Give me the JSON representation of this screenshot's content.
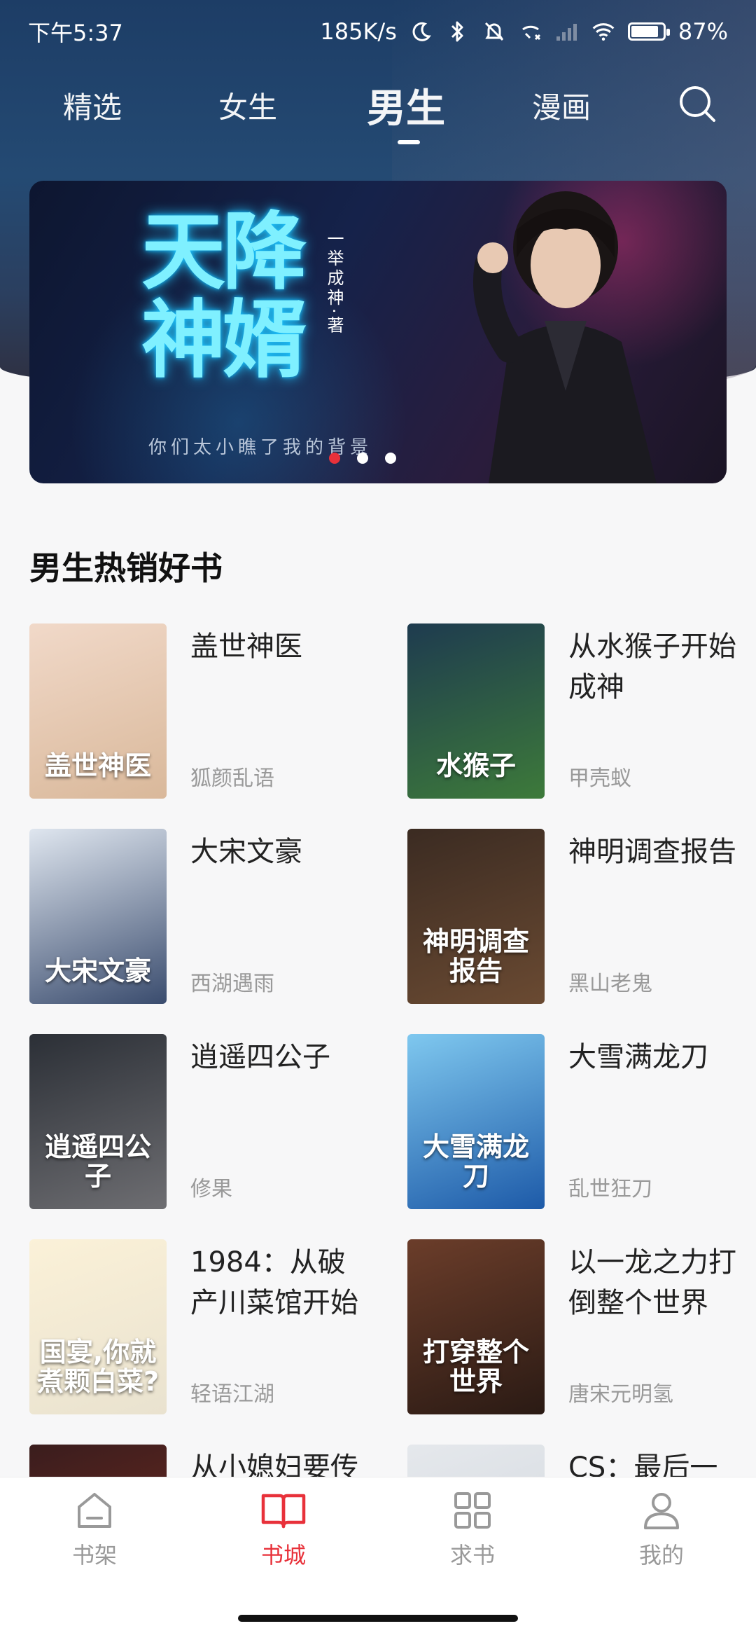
{
  "status_bar": {
    "time": "下午5:37",
    "speed": "185K/s",
    "battery_text": "87%",
    "battery_level": 0.87
  },
  "tabs": [
    {
      "label": "精选"
    },
    {
      "label": "女生"
    },
    {
      "label": "男生"
    },
    {
      "label": "漫画"
    }
  ],
  "active_tab": "男生",
  "banner": {
    "title": "天降神婿",
    "author_vertical": "一举成神·著",
    "subtitle": "你们太小瞧了我的背景",
    "page_index": 1,
    "page_count": 3
  },
  "section": {
    "title": "男生热销好书"
  },
  "books": [
    {
      "title": "盖世神医",
      "author": "狐颜乱语",
      "cover_text": "盖世神医",
      "cover_colors": [
        "#f1d9c9",
        "#d9b89a"
      ]
    },
    {
      "title": "从水猴子开始成神",
      "author": "甲壳蚁",
      "cover_text": "水猴子",
      "cover_colors": [
        "#1e3b4f",
        "#3d7a3a"
      ]
    },
    {
      "title": "大宋文豪",
      "author": "西湖遇雨",
      "cover_text": "大宋文豪",
      "cover_colors": [
        "#dfe6ef",
        "#3a4c6e"
      ]
    },
    {
      "title": "神明调查报告",
      "author": "黑山老鬼",
      "cover_text": "神明调查报告",
      "cover_colors": [
        "#3b2b22",
        "#6a4a32"
      ]
    },
    {
      "title": "逍遥四公子",
      "author": "修果",
      "cover_text": "逍遥四公子",
      "cover_colors": [
        "#2b2f36",
        "#6e6e72"
      ]
    },
    {
      "title": "大雪满龙刀",
      "author": "乱世狂刀",
      "cover_text": "大雪满龙刀",
      "cover_colors": [
        "#7fc8ef",
        "#1d5aa8"
      ]
    },
    {
      "title": "1984：从破产川菜馆开始",
      "author": "轻语江湖",
      "cover_text": "国宴,你就煮颗白菜?",
      "cover_colors": [
        "#fbf1d8",
        "#e9e2cf"
      ]
    },
    {
      "title": "以一龙之力打倒整个世界",
      "author": "唐宋元明氢",
      "cover_text": "打穿整个世界",
      "cover_colors": [
        "#6b3d2a",
        "#2a1a14"
      ]
    },
    {
      "title": "从小媳妇要传宗接代",
      "author": "",
      "cover_text": "",
      "cover_colors": [
        "#3a1d1d",
        "#7a2c22"
      ]
    },
    {
      "title": "CS：最后一舞，舞成",
      "author": "",
      "cover_text": "",
      "cover_colors": [
        "#e5e8ec",
        "#cfd5dc"
      ]
    }
  ],
  "bottom_nav": [
    {
      "label": "书架",
      "icon": "shelf-icon"
    },
    {
      "label": "书城",
      "icon": "book-icon"
    },
    {
      "label": "求书",
      "icon": "grid-icon"
    },
    {
      "label": "我的",
      "icon": "user-icon"
    }
  ],
  "active_nav": "书城",
  "colors": {
    "accent": "#e8313a",
    "header": "#1d3d66",
    "muted": "#999999"
  }
}
